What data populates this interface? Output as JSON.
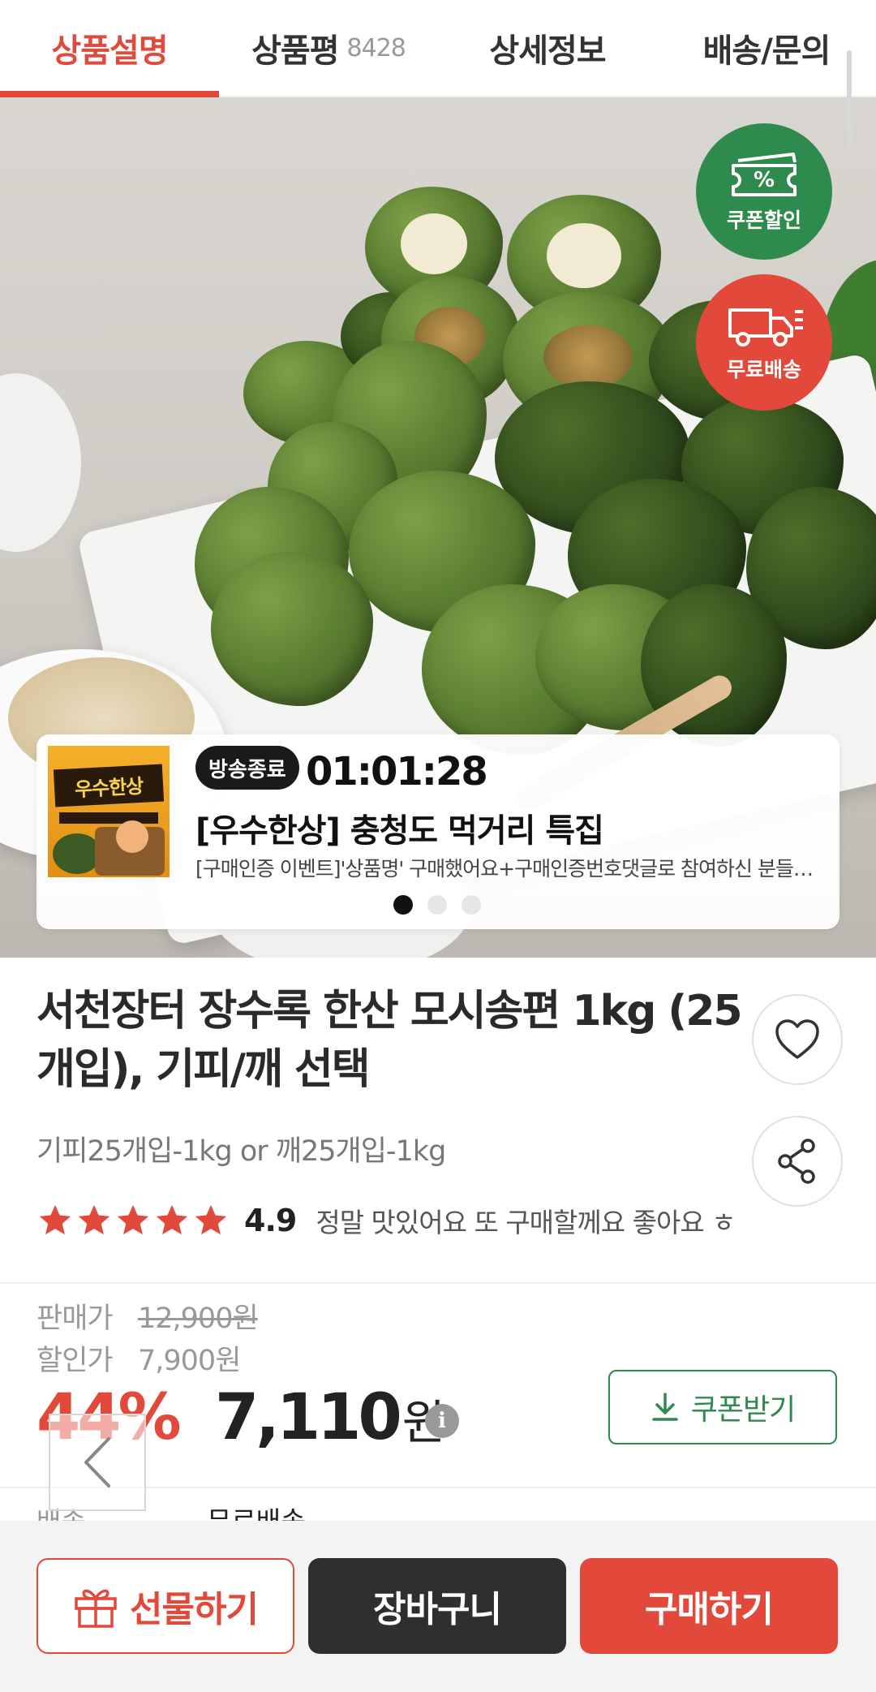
{
  "tabs": [
    {
      "label": "상품설명",
      "active": true
    },
    {
      "label": "상품평",
      "count": "8428"
    },
    {
      "label": "상세정보"
    },
    {
      "label": "배송/문의"
    }
  ],
  "badges": {
    "coupon_label": "쿠폰할인",
    "coupon_symbol": "%",
    "shipping_label": "무료배송"
  },
  "live": {
    "status": "방송종료",
    "timer": "01:01:28",
    "title": "[우수한상] 충청도 먹거리 특집",
    "description": "[구매인증 이벤트]'상품명' 구매했어요+구매인증번호댓글로 참여하신 분들…",
    "thumb_title": "우수한상",
    "slide_count": 3,
    "active_slide": 1
  },
  "product": {
    "title": "서천장터 장수록 한산 모시송편 1kg (25개입), 기피/깨 선택",
    "option": "기피25개입-1kg or 깨25개입-1kg",
    "rating": "4.9",
    "stars": 5,
    "review_snippet": "정말 맛있어요 또 구매할께요 좋아요 ㅎ"
  },
  "price": {
    "sale_label": "판매가",
    "sale_value": "12,900원",
    "discount_label": "할인가",
    "discount_value": "7,900원",
    "discount_rate": "44%",
    "final_value": "7,110",
    "final_unit": "원",
    "info_symbol": "i",
    "coupon_button": "쿠폰받기"
  },
  "shipping": {
    "label": "배송",
    "value": "무료배송"
  },
  "bottom": {
    "gift": "선물하기",
    "cart": "장바구니",
    "buy": "구매하기"
  },
  "colors": {
    "accent": "#e2493a",
    "coupon_green": "#2f8a4e",
    "cart_dark": "#2f2f2f"
  }
}
